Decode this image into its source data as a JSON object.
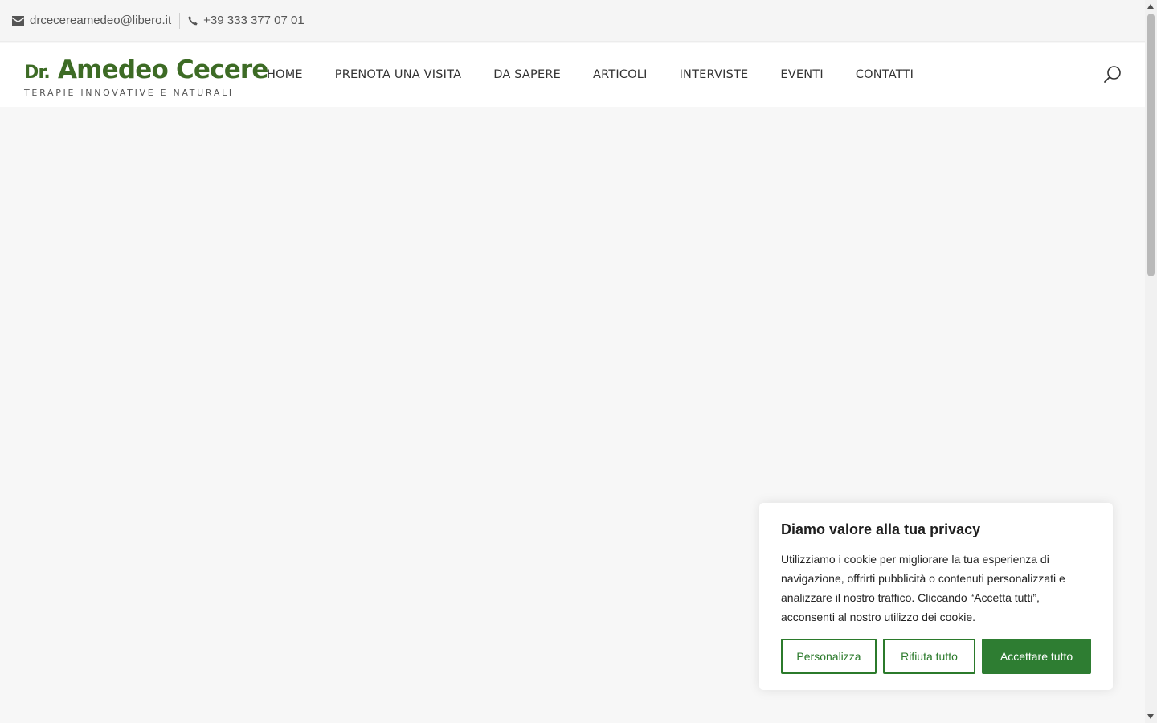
{
  "topbar": {
    "email": "drcecereamedeo@libero.it",
    "phone": "+39 333 377 07 01",
    "email_icon": "envelope-icon",
    "phone_icon": "phone-icon"
  },
  "header": {
    "logo": {
      "prefix": "Dr.",
      "name": "Amedeo Cecere",
      "tagline": "TERAPIE INNOVATIVE E NATURALI"
    },
    "nav": [
      "HOME",
      "PRENOTA UNA VISITA",
      "DA SAPERE",
      "ARTICOLI",
      "INTERVISTE",
      "EVENTI",
      "CONTATTI"
    ],
    "search_icon": "search-icon"
  },
  "cookie_banner": {
    "title": "Diamo valore alla tua privacy",
    "text": "Utilizziamo i cookie per migliorare la tua esperienza di navigazione, offrirti pubblicità o contenuti personalizzati e analizzare il nostro traffico. Cliccando “Accetta tutti”, acconsenti al nostro utilizzo dei cookie.",
    "customize_label": "Personalizza",
    "reject_label": "Rifiuta tutto",
    "accept_label": "Accettare tutto"
  },
  "colors": {
    "brand_green": "#3d6b25",
    "button_green": "#2e7d32"
  }
}
